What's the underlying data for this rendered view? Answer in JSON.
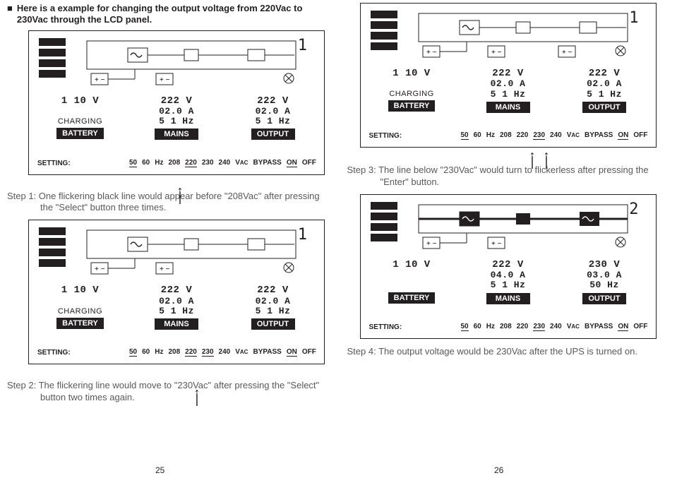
{
  "intro": {
    "bullet": "■",
    "text": "Here is a example for changing the output voltage from 220Vac to 230Vac through the LCD panel."
  },
  "steps": {
    "s1": "Step 1: One flickering black line would appear before \"208Vac\" after pressing the \"Select\" button three times.",
    "s2": "Step 2: The flickering line would move to \"230Vac\" after pressing the \"Select\" button two times again.",
    "s3": "Step 3: The line below \"230Vac\" would turn to flickerless after pressing the \"Enter\" button.",
    "s4": "Step 4: The output voltage would be 230Vac after the UPS is turned on."
  },
  "page_left": "25",
  "page_right": "26",
  "lcd_common": {
    "page1": "1",
    "page2": "2",
    "battery": {
      "v": "1 10 V",
      "charging": "CHARGING",
      "label": "BATTERY"
    },
    "mains": {
      "v": "222 V",
      "a": "02.0 A",
      "hz": "5 1 Hz",
      "label": "MAINS"
    },
    "output": {
      "v": "222 V",
      "a": "02.0 A",
      "hz": "5 1 Hz",
      "label": "OUTPUT"
    },
    "mains4": {
      "v": "222 V",
      "a": "04.0 A",
      "hz": "5 1 Hz"
    },
    "output4": {
      "v": "230 V",
      "a": "03.0 A",
      "hz": "50 Hz"
    },
    "setting": "SETTING:",
    "opts": {
      "o50": "50",
      "o60": "60",
      "hz": "Hz",
      "o208": "208",
      "o220": "220",
      "o230": "230",
      "o240": "240",
      "vac": "V",
      "vacs": "AC",
      "bypass": "BYPASS",
      "on": "ON",
      "off": "OFF"
    }
  }
}
